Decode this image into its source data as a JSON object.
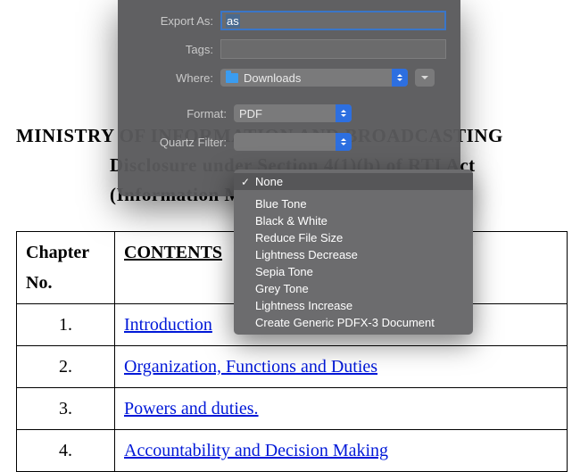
{
  "document": {
    "title_line1": "MINISTRY OF INFORMATION AND BROADCASTING",
    "title_line2": "Disclosure under Section 4(1)(b) of RTI Act",
    "title_line3": "(Information Manual)",
    "table": {
      "header_chapter": "Chapter No.",
      "header_contents": "CONTENTS",
      "rows": [
        {
          "no": "1.",
          "text": "Introduction"
        },
        {
          "no": "2.",
          "text": "Organization, Functions and Duties"
        },
        {
          "no": "3.",
          "text": "Powers and duties."
        },
        {
          "no": "4.",
          "text": "Accountability and Decision Making"
        }
      ]
    }
  },
  "sheet": {
    "export_as_label": "Export As:",
    "export_as_value": "as",
    "tags_label": "Tags:",
    "where_label": "Where:",
    "where_value": "Downloads",
    "format_label": "Format:",
    "format_value": "PDF",
    "quartz_label": "Quartz Filter:"
  },
  "menu": {
    "selected": "None",
    "items": [
      "Blue Tone",
      "Black & White",
      "Reduce File Size",
      "Lightness Decrease",
      "Sepia Tone",
      "Grey Tone",
      "Lightness Increase",
      "Create Generic PDFX-3 Document"
    ]
  }
}
